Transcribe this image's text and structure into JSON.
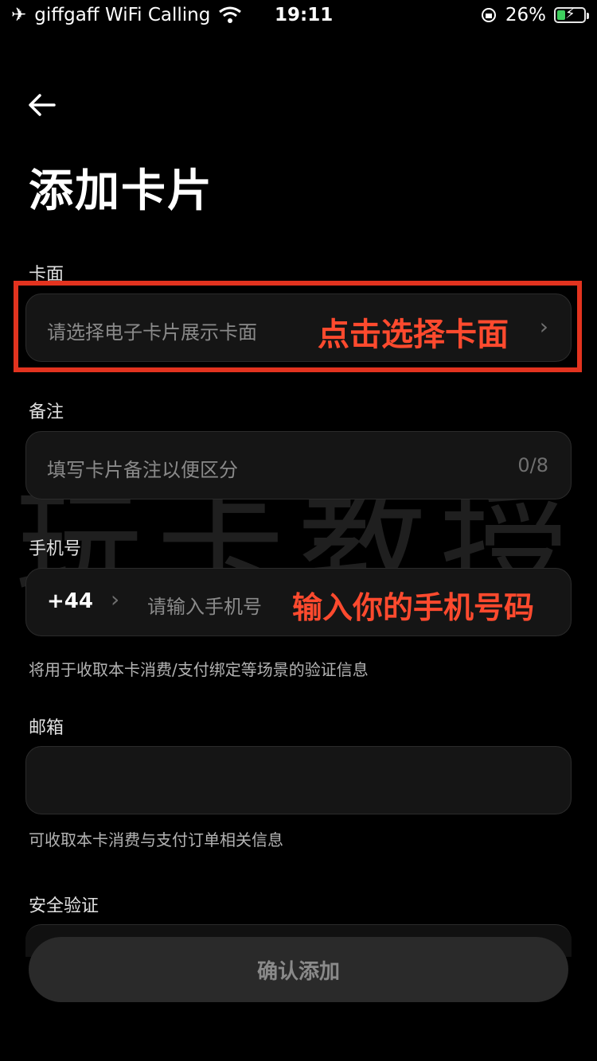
{
  "status_bar": {
    "carrier": "giffgaff WiFi Calling",
    "time": "19:11",
    "battery": "26%"
  },
  "page": {
    "title": "添加卡片"
  },
  "card_face": {
    "label": "卡面",
    "placeholder": "请选择电子卡片展示卡面",
    "annotation": "点击选择卡面"
  },
  "remark": {
    "label": "备注",
    "placeholder": "填写卡片备注以便区分",
    "counter": "0/8"
  },
  "phone": {
    "label": "手机号",
    "country_code": "+44",
    "placeholder": "请输入手机号",
    "annotation": "输入你的手机号码",
    "hint": "将用于收取本卡消费/支付绑定等场景的验证信息"
  },
  "email": {
    "label": "邮箱",
    "hint": "可收取本卡消费与支付订单相关信息"
  },
  "security": {
    "label": "安全验证"
  },
  "confirm_button": {
    "label": "确认添加"
  },
  "watermark": {
    "text": "玩卡教授"
  },
  "colors": {
    "background": "#000000",
    "field_bg": "#151515",
    "annotation_red": "#ff4a2e"
  }
}
